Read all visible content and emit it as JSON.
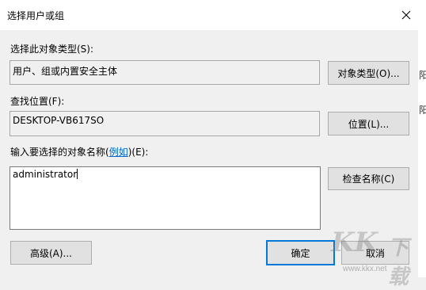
{
  "dialog": {
    "title": "选择用户或组",
    "object_type_label": "选择此对象类型(S):",
    "object_type_value": "用户、组或内置安全主体",
    "object_types_button": "对象类型(O)...",
    "location_label": "查找位置(F):",
    "location_value": "DESKTOP-VB617SO",
    "locations_button": "位置(L)...",
    "enter_names_label_before": "输入要选择的对象名称(",
    "enter_names_link": "例如",
    "enter_names_label_after": ")(E):",
    "names_value": "administrator",
    "check_names_button": "检查名称(C)",
    "advanced_button": "高级(A)...",
    "ok_button": "确定",
    "cancel_button": "取消"
  },
  "background": {
    "partial_text_1": "阳",
    "partial_text_2": "阳"
  },
  "watermark": {
    "brand": "KK",
    "suffix": "下载",
    "url": "www.kkx.net"
  }
}
